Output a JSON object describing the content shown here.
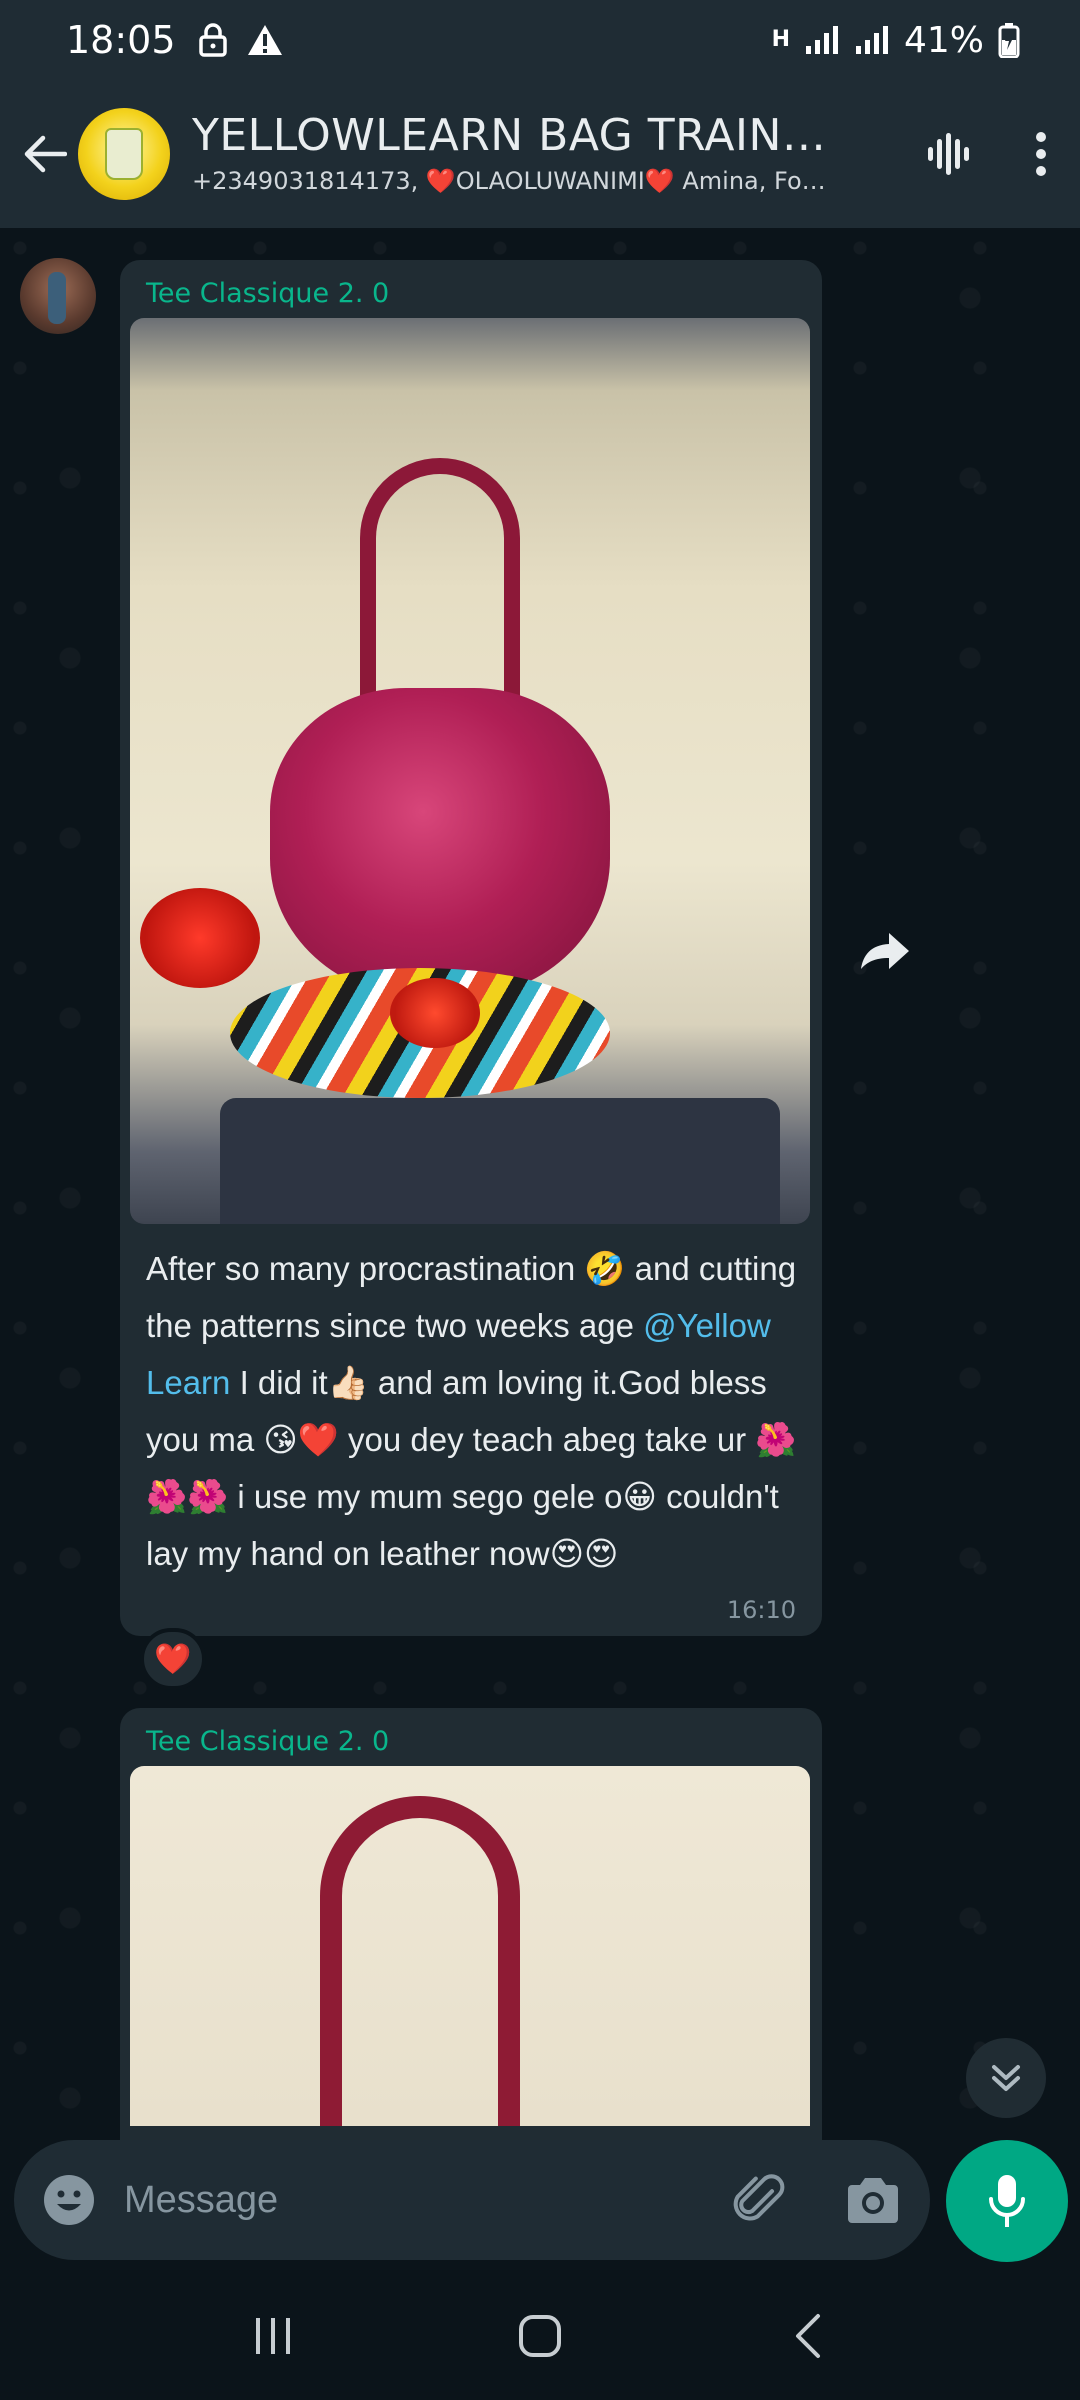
{
  "status_bar": {
    "time": "18:05",
    "network": "H",
    "battery": "41%"
  },
  "header": {
    "title": "YELLOWLEARN BAG TRAININ...",
    "members": "+2349031814173, ❤️OLAOLUWANIMI❤️ Amina, Foluwa..."
  },
  "messages": [
    {
      "sender": "Tee Classique 2. 0",
      "text_before_mention": "After so many procrastination 🤣 and cutting the patterns since two weeks age ",
      "mention": "@Yellow Learn",
      "text_after_mention": "  I did it👍🏻 and am loving it.God bless you ma 😘❤️ you dey teach abeg take ur 🌺🌺🌺 i use my mum sego gele o😀 couldn't lay my hand on leather now😍😍",
      "time": "16:10",
      "reaction": "❤️"
    },
    {
      "sender": "Tee Classique 2. 0"
    }
  ],
  "composer": {
    "placeholder": "Message"
  },
  "colors": {
    "header_bg": "#1f2c34",
    "chat_bg": "#0b141a",
    "bubble_bg": "#202c33",
    "accent_green": "#00a884",
    "mention_blue": "#53bdeb"
  },
  "icons": {
    "back": "back-arrow-icon",
    "voice_chat": "voice-waveform-icon",
    "menu": "more-vertical-icon",
    "forward": "forward-arrow-icon",
    "scroll": "double-chevron-down-icon",
    "emoji": "emoji-icon",
    "attach": "paperclip-icon",
    "camera": "camera-icon",
    "mic": "microphone-icon"
  }
}
